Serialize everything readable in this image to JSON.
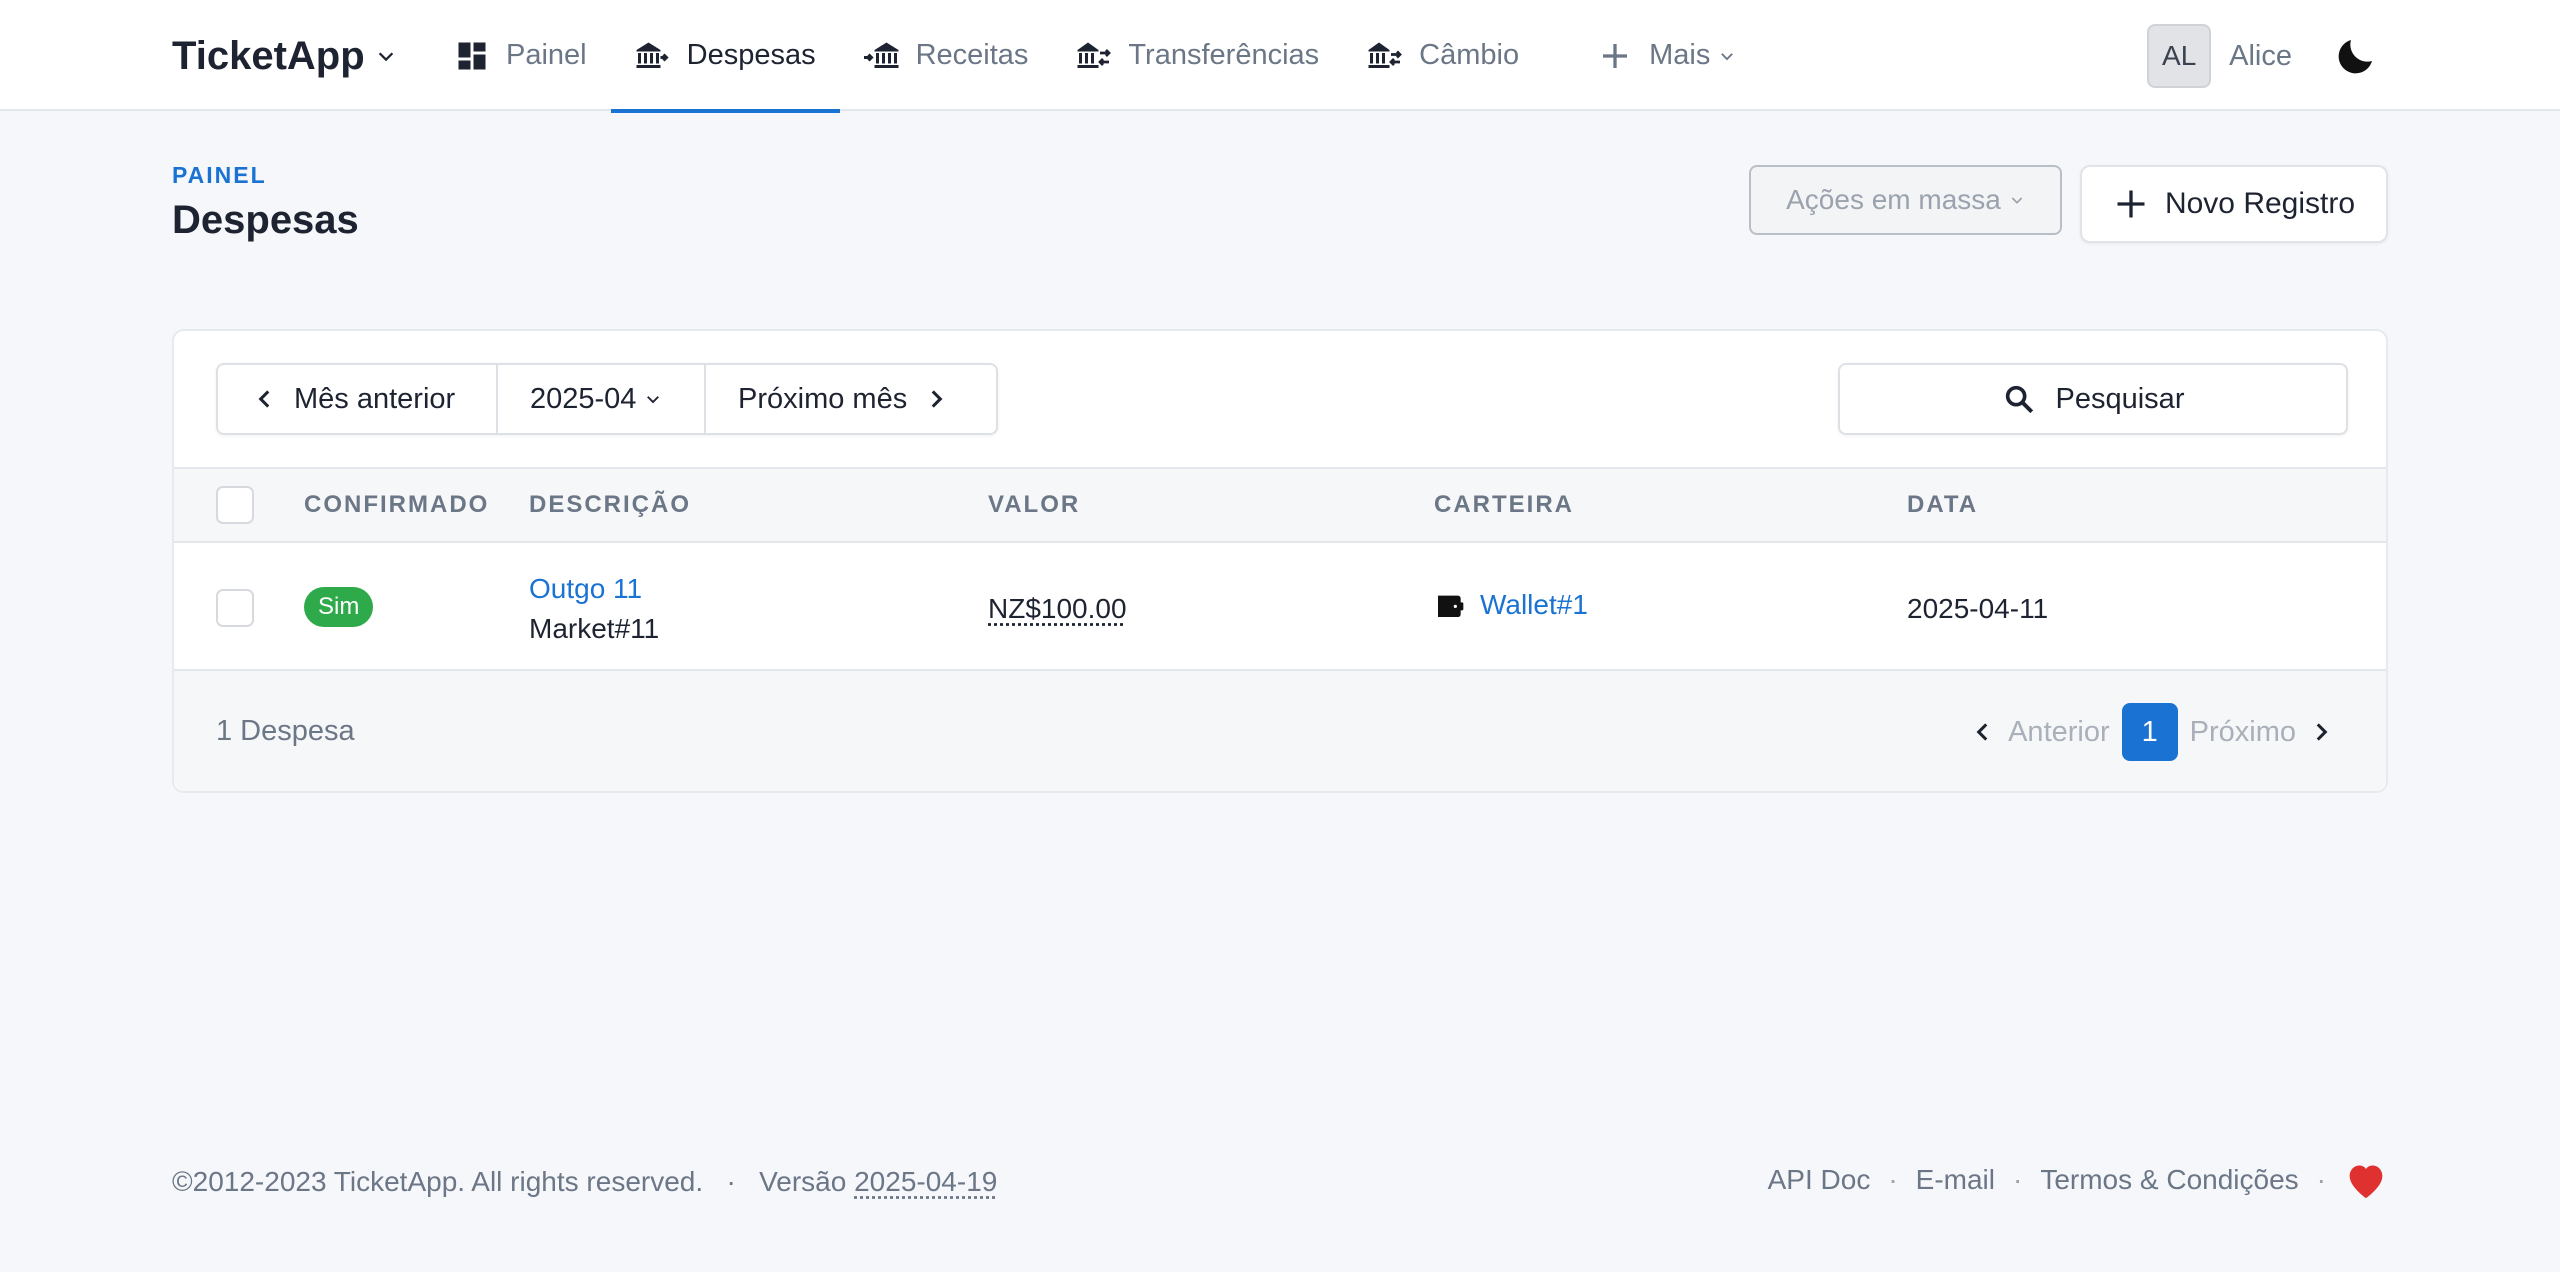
{
  "navbar": {
    "brand": "TicketApp",
    "items": [
      {
        "label": "Painel",
        "icon": "dashboard-icon"
      },
      {
        "label": "Despesas",
        "icon": "bank-out-icon",
        "active": true
      },
      {
        "label": "Receitas",
        "icon": "bank-in-icon"
      },
      {
        "label": "Transferências",
        "icon": "bank-transfer-icon"
      },
      {
        "label": "Câmbio",
        "icon": "bank-exchange-icon"
      },
      {
        "label": "Mais",
        "icon": "plus-icon"
      }
    ],
    "user_initials": "AL",
    "username": "Alice"
  },
  "page": {
    "breadcrumb": "PAINEL",
    "title": "Despesas",
    "bulk_actions": "Ações em massa",
    "new_record": "Novo Registro"
  },
  "filters": {
    "prev_month": "Mês anterior",
    "current_month": "2025-04",
    "next_month": "Próximo mês",
    "search": "Pesquisar"
  },
  "table": {
    "columns": [
      "CONFIRMADO",
      "DESCRIÇÃO",
      "VALOR",
      "CARTEIRA",
      "DATA"
    ],
    "rows": [
      {
        "confirmed": "Sim",
        "description_title": "Outgo 11",
        "description_sub": "Market#11",
        "value": "NZ$100.00",
        "wallet": "Wallet#1",
        "date": "2025-04-11"
      }
    ]
  },
  "pagination": {
    "count": "1 Despesa",
    "prev": "Anterior",
    "page": "1",
    "next": "Próximo"
  },
  "footer": {
    "copyright": "©2012-2023 TicketApp. All rights reserved.",
    "sep": "·",
    "version_label": "Versão",
    "version": "2025-04-19",
    "links": [
      "API Doc",
      "E-mail",
      "Termos & Condições"
    ]
  },
  "colors": {
    "accent": "#1a73d2",
    "success": "#2eaa4a",
    "heart": "#e03131"
  }
}
